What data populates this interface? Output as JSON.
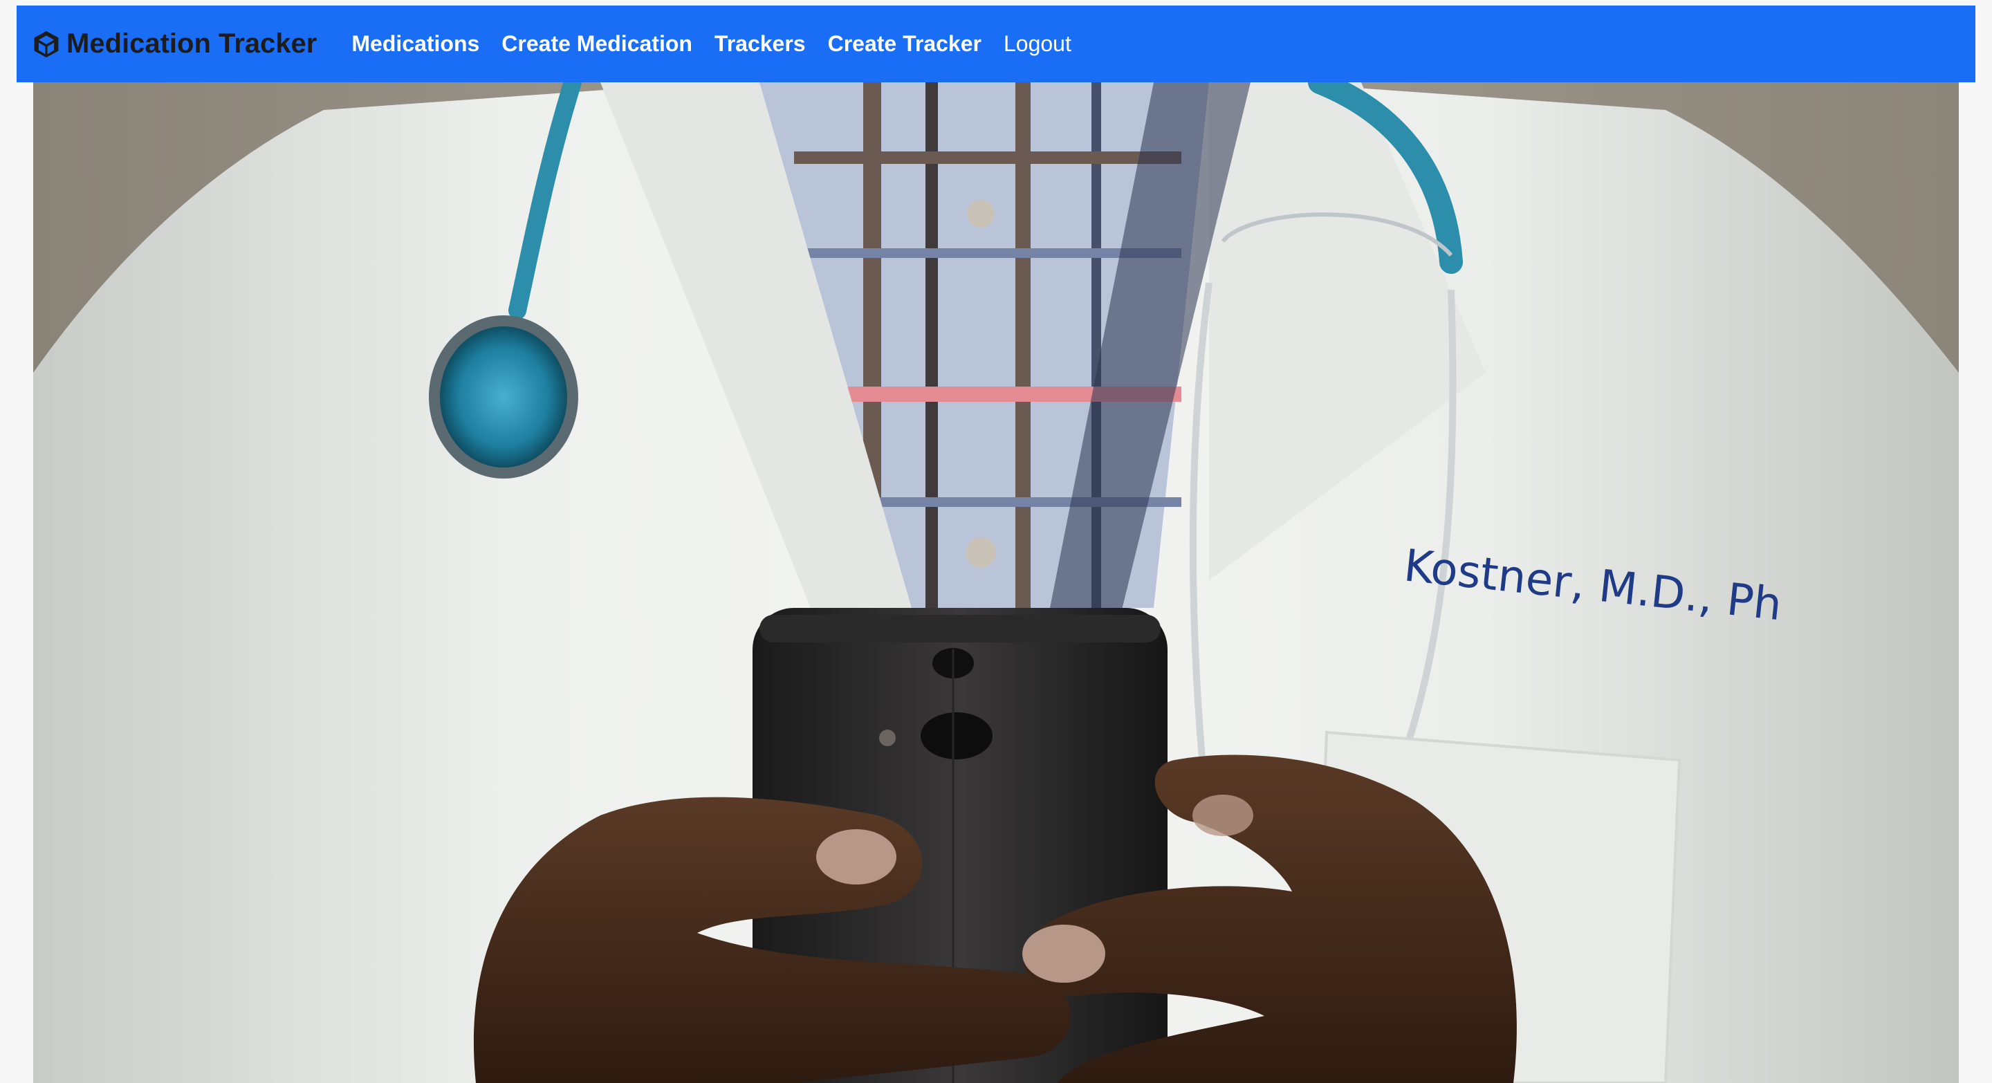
{
  "navbar": {
    "brand": "Medication Tracker",
    "brand_icon": "cube-logo-icon",
    "links": [
      {
        "label": "Medications"
      },
      {
        "label": "Create Medication"
      },
      {
        "label": "Trackers"
      },
      {
        "label": "Create Tracker"
      },
      {
        "label": "Logout"
      }
    ],
    "background_color": "#1a6ef5",
    "link_color": "#ffffff"
  },
  "hero": {
    "alt": "Doctor in white coat with stethoscope holding a smartphone",
    "coat_embroidery": "Kostner, M.D., Ph"
  }
}
